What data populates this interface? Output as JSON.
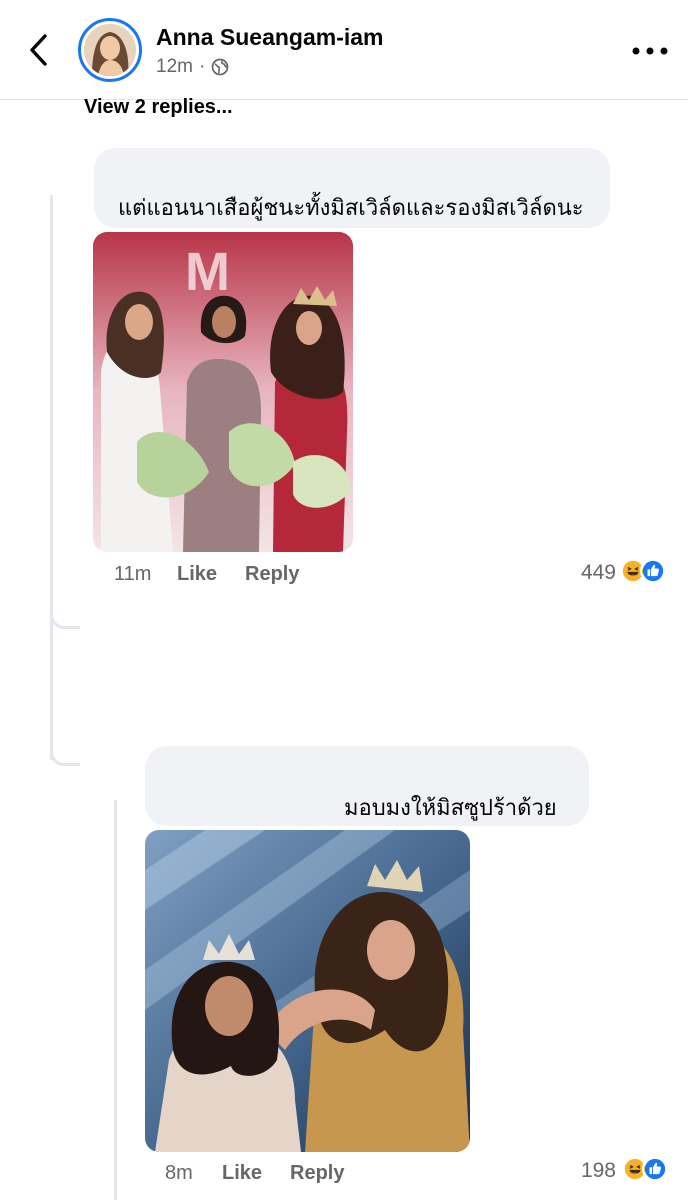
{
  "header": {
    "name": "Anna Sueangam-iam",
    "time": "12m",
    "separator": "·",
    "icons": {
      "back": "back-chevron-icon",
      "privacy": "globe-icon",
      "more": "more-horizontal-icon"
    }
  },
  "thread": {
    "view_replies_label": "View 2 replies..."
  },
  "comments": [
    {
      "text": "แต่แอนนาเสือผู้ชนะทั้งมิสเวิล์ดและรองมิสเวิล์ดนะ",
      "time": "11m",
      "like_label": "Like",
      "reply_label": "Reply",
      "reaction_count": "449",
      "reactions": [
        "haha-reaction-icon",
        "like-reaction-icon"
      ],
      "photo_text": "M"
    },
    {
      "text": "มอบมงให้มิสซูปร้าด้วย",
      "time": "8m",
      "like_label": "Like",
      "reply_label": "Reply",
      "reaction_count": "198",
      "reactions": [
        "haha-reaction-icon",
        "like-reaction-icon"
      ]
    }
  ],
  "colors": {
    "accent": "#1877f2",
    "text_primary": "#050505",
    "text_secondary": "#65676b",
    "bubble_bg": "#f0f2f5",
    "thread_line": "#e4e6eb",
    "haha_yellow": "#f7b125"
  }
}
